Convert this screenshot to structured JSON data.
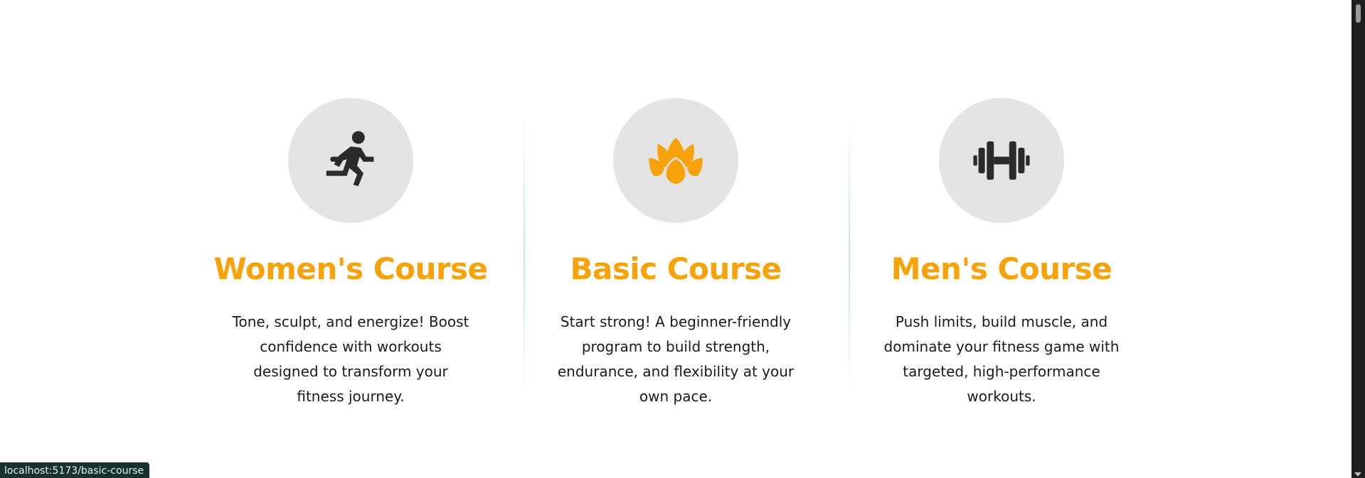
{
  "courses": [
    {
      "title": "Women's Course",
      "description": "Tone, sculpt, and energize! Boost confidence with workouts designed to transform your fitness journey.",
      "icon": "running-person-icon"
    },
    {
      "title": "Basic Course",
      "description": "Start strong! A beginner-friendly program to build strength, endurance, and flexibility at your own pace.",
      "icon": "lotus-icon"
    },
    {
      "title": "Men's Course",
      "description": "Push limits, build muscle, and dominate your fitness game with targeted, high-performance workouts.",
      "icon": "dumbbell-icon"
    }
  ],
  "status_bar": {
    "url": "localhost:5173/basic-course"
  },
  "colors": {
    "accent": "#f7a10b",
    "icon_dark": "#2b2b2b",
    "icon_circle": "#e5e4e5",
    "text": "#1a1a1a"
  }
}
